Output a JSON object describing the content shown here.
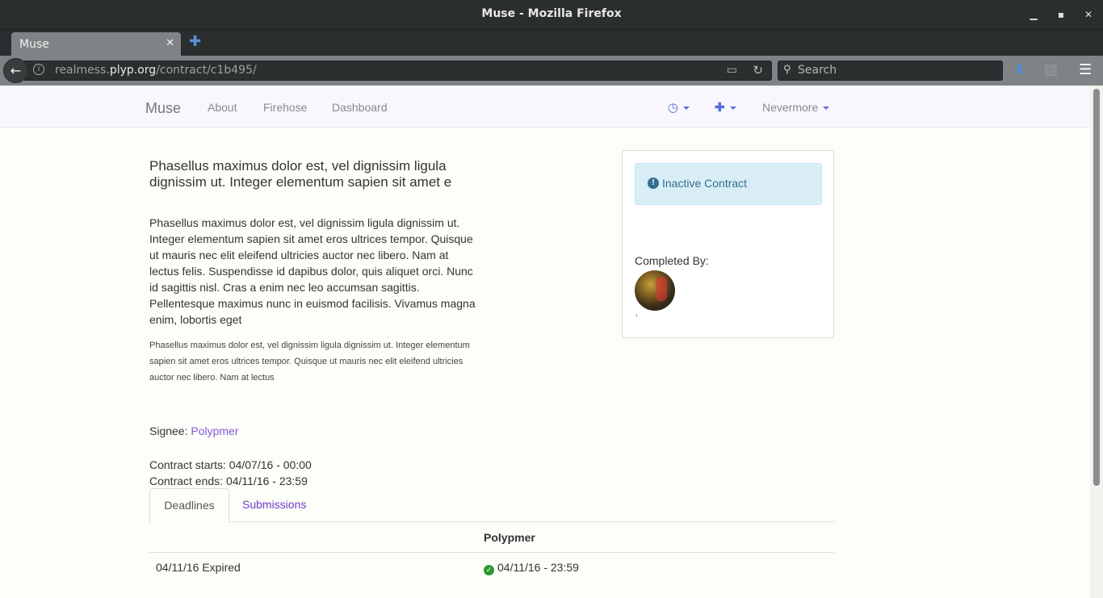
{
  "window": {
    "title": "Muse - Mozilla Firefox"
  },
  "browser": {
    "tab_title": "Muse",
    "url_domain": "realmess.",
    "url_host": "plyp.org",
    "url_path": "/contract/c1b495/",
    "search_placeholder": "Search"
  },
  "site_nav": {
    "brand": "Muse",
    "links": [
      "About",
      "Firehose",
      "Dashboard"
    ],
    "user_menu": "Nevermore"
  },
  "contract": {
    "title": "Phasellus maximus dolor est, vel dignissim ligula dignissim ut. Integer elementum sapien sit amet e",
    "body": "Phasellus maximus dolor est, vel dignissim ligula dignissim ut. Integer elementum sapien sit amet eros ultrices tempor. Quisque ut mauris nec elit eleifend ultricies auctor nec libero. Nam at lectus felis. Suspendisse id dapibus dolor, quis aliquet orci. Nunc id sagittis nisl. Cras a enim nec leo accumsan sagittis. Pellentesque maximus nunc in euismod facilisis. Vivamus magna enim, lobortis eget",
    "small": "Phasellus maximus dolor est, vel dignissim ligula dignissim ut. Integer elementum sapien sit amet eros ultrices tempor. Quisque ut mauris nec elit eleifend ultricies auctor nec libero. Nam at lectus",
    "signee_label": "Signee:",
    "signee_name": "Polypmer",
    "starts": "Contract starts: 04/07/16 - 00:00",
    "ends": "Contract ends: 04/11/16 - 23:59"
  },
  "status_panel": {
    "alert": "Inactive Contract",
    "completed_by": "Completed By:",
    "avatar_caption": ","
  },
  "tabs": {
    "deadlines": "Deadlines",
    "submissions": "Submissions"
  },
  "deadline_table": {
    "header": "Polypmer",
    "rows": [
      {
        "deadline": "04/11/16 Expired",
        "submitted": "04/11/16 - 23:59"
      }
    ]
  }
}
